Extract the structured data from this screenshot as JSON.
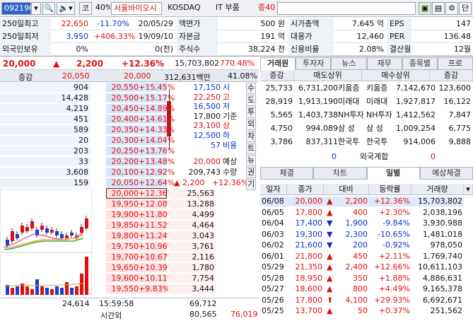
{
  "toolbar": {
    "code": "092190",
    "market_btn": "코",
    "percent": "40%",
    "name": "서울바이오시",
    "exchange": "KOSDAQ",
    "sector": "IT 부품",
    "margin": "증40",
    "right_btn": "단"
  },
  "info": {
    "rows": [
      [
        {
          "l": "250일최고"
        },
        {
          "v": "22,650",
          "c": "red"
        },
        {
          "v": "-11.70%",
          "c": "blue"
        },
        {
          "v": "20/05/29"
        },
        {
          "l": "액면가"
        },
        {
          "v": "500 원"
        },
        {
          "l": "시가총액"
        },
        {
          "v": "7,645 억"
        },
        {
          "l": "EPS"
        },
        {
          "v": "147"
        }
      ],
      [
        {
          "l": "250일최저"
        },
        {
          "v": "3,950",
          "c": "blue"
        },
        {
          "v": "+406.33%",
          "c": "red"
        },
        {
          "v": "19/09/10"
        },
        {
          "l": "자본금"
        },
        {
          "v": "191 억"
        },
        {
          "l": "대용가"
        },
        {
          "v": "12,460"
        },
        {
          "l": "PER"
        },
        {
          "v": "136.48"
        }
      ],
      [
        {
          "l": "외국인보유"
        },
        {
          "v": "0%"
        },
        {
          "v": ""
        },
        {
          "v": "0(천)"
        },
        {
          "l": "주식수"
        },
        {
          "v": "38,224 천"
        },
        {
          "l": "신용비율"
        },
        {
          "v": "2.08%"
        },
        {
          "l": "결산월"
        },
        {
          "v": "12월"
        }
      ]
    ]
  },
  "price": {
    "current": "20,000",
    "arrow": "▲",
    "change": "2,200",
    "rate": "+12.36%",
    "volume": "15,703,802",
    "vol_rate": "770.48%"
  },
  "orderbook": {
    "header": {
      "label": "증감",
      "ask_total": "20,050",
      "price": "20,000",
      "amount": "312,631백만",
      "pct": "41.08%"
    },
    "asks": [
      {
        "qty": "904",
        "price": "20,550",
        "rate": "+15.45%"
      },
      {
        "qty": "14,428",
        "price": "20,500",
        "rate": "+15.17%"
      },
      {
        "qty": "4,219",
        "price": "20,450",
        "rate": "+14.89%"
      },
      {
        "qty": "451",
        "price": "20,400",
        "rate": "+14.61%"
      },
      {
        "qty": "589",
        "price": "20,350",
        "rate": "+14.33%"
      },
      {
        "qty": "20",
        "price": "20,300",
        "rate": "+14.04%"
      },
      {
        "qty": "203",
        "price": "20,250",
        "rate": "+13.76%"
      },
      {
        "qty": "33",
        "price": "20,200",
        "rate": "+13.48%"
      },
      {
        "qty": "3,608",
        "price": "20,100",
        "rate": "+12.92%"
      },
      {
        "qty": "159",
        "price": "20,050",
        "rate": "+12.64%"
      }
    ],
    "bids": [
      {
        "price": "20,000",
        "rate": "+12.36%",
        "qty": "25,563"
      },
      {
        "price": "19,950",
        "rate": "+12.08%",
        "qty": "13,288"
      },
      {
        "price": "19,900",
        "rate": "+11.80%",
        "qty": "4,499"
      },
      {
        "price": "19,850",
        "rate": "+11.52%",
        "qty": "4,464"
      },
      {
        "price": "19,800",
        "rate": "+11.24%",
        "qty": "3,043"
      },
      {
        "price": "19,750",
        "rate": "+10.96%",
        "qty": "3,761"
      },
      {
        "price": "19,700",
        "rate": "+10.67%",
        "qty": "2,116"
      },
      {
        "price": "19,650",
        "rate": "+10.39%",
        "qty": "1,780"
      },
      {
        "price": "19,600",
        "rate": "+10.11%",
        "qty": "7,754"
      },
      {
        "price": "19,550",
        "rate": "+9.83%",
        "qty": "3,444"
      }
    ],
    "ohlc": [
      {
        "v": "17,150",
        "l": "시"
      },
      {
        "v": "22,250",
        "l": "고"
      },
      {
        "v": "16,500",
        "l": "저"
      },
      {
        "v": "17,800",
        "l": "기준"
      },
      {
        "v": "23,100",
        "l": "상"
      },
      {
        "v": "12,500",
        "l": "하"
      },
      {
        "v": "57",
        "l": "비용"
      }
    ],
    "expected": {
      "price": "20,000",
      "price_l": "예상",
      "vol": "209,743",
      "vol_l": "수량",
      "chg": "▲ 2,200",
      "rate": "+12.36%"
    },
    "side": [
      "수",
      "도",
      "투",
      "외",
      "차",
      "트",
      "뉴",
      "권",
      "기"
    ],
    "footer": {
      "left": "24,614",
      "time": "15:59:58",
      "time_label": "시간외",
      "v1": "69,712",
      "v2": "80,565",
      "v3": "76,019"
    }
  },
  "broker": {
    "tabs": [
      "거래원",
      "투자자",
      "뉴스",
      "재무",
      "종목별",
      "프로"
    ],
    "headers": [
      "증감",
      "매도상위",
      "매수상위",
      "증감"
    ],
    "rows": [
      {
        "a": "25,733",
        "b": "6,731,200",
        "c": "키움증",
        "d": "키움증",
        "e": "7,142,670",
        "f": "123,600"
      },
      {
        "a": "28,919",
        "b": "1,913,190",
        "c": "미래대",
        "d": "미래대",
        "e": "1,927,817",
        "f": "16,122"
      },
      {
        "a": "5,565",
        "b": "1,403,738",
        "c": "NH투자",
        "d": "NH투자",
        "e": "1,412,562",
        "f": "7,847"
      },
      {
        "a": "4,750",
        "b": "994,089",
        "c": "삼 성",
        "d": "삼 성",
        "e": "1,009,254",
        "f": "6,775"
      },
      {
        "a": "3,786",
        "b": "837,311",
        "c": "한국투",
        "d": "한국투",
        "e": "914,006",
        "f": "9,888"
      }
    ],
    "foreign": {
      "left": "0",
      "label": "외국계합",
      "right": "0"
    }
  },
  "daily": {
    "tabs": [
      "체결",
      "차트",
      "일별",
      "예상체결"
    ],
    "headers": [
      "일자",
      "종가",
      "대비",
      "등락률",
      "거래량"
    ],
    "rows": [
      {
        "d": "06/08",
        "p": "20,000",
        "a": "▲",
        "c": "2,200",
        "r": "+12.36%",
        "v": "15,703,802",
        "col": "red",
        "sel": true
      },
      {
        "d": "06/05",
        "p": "17,800",
        "a": "▲",
        "c": "400",
        "r": "+2.30%",
        "v": "2,038,196",
        "col": "red"
      },
      {
        "d": "06/04",
        "p": "17,400",
        "a": "▼",
        "c": "1,900",
        "r": "-9.84%",
        "v": "3,930,988",
        "col": "blue"
      },
      {
        "d": "06/03",
        "p": "19,300",
        "a": "▼",
        "c": "2,300",
        "r": "-10.65%",
        "v": "1,481,018",
        "col": "blue"
      },
      {
        "d": "06/02",
        "p": "21,600",
        "a": "▼",
        "c": "200",
        "r": "-0.92%",
        "v": "978,050",
        "col": "blue"
      },
      {
        "d": "06/01",
        "p": "21,800",
        "a": "▲",
        "c": "450",
        "r": "+2.11%",
        "v": "1,769,740",
        "col": "red"
      },
      {
        "d": "05/29",
        "p": "21,350",
        "a": "▲",
        "c": "2,400",
        "r": "+12.66%",
        "v": "10,611,103",
        "col": "red"
      },
      {
        "d": "05/28",
        "p": "18,950",
        "a": "▲",
        "c": "350",
        "r": "+1.88%",
        "v": "4,886,631",
        "col": "red"
      },
      {
        "d": "05/27",
        "p": "18,600",
        "a": "▲",
        "c": "800",
        "r": "+4.49%",
        "v": "9,165,378",
        "col": "red"
      },
      {
        "d": "05/26",
        "p": "17,800",
        "a": "⬆",
        "c": "4,100",
        "r": "+29.93%",
        "v": "6,692,671",
        "col": "red"
      },
      {
        "d": "05/25",
        "p": "13,700",
        "a": "▲",
        "c": "50",
        "r": "+0.37%",
        "v": "251,562",
        "col": "red"
      }
    ]
  },
  "colors": {
    "up": "#e01010",
    "down": "#0a2fd0",
    "ask_bg": "#d7e6f9",
    "bid_bg": "#fbe2e2"
  }
}
